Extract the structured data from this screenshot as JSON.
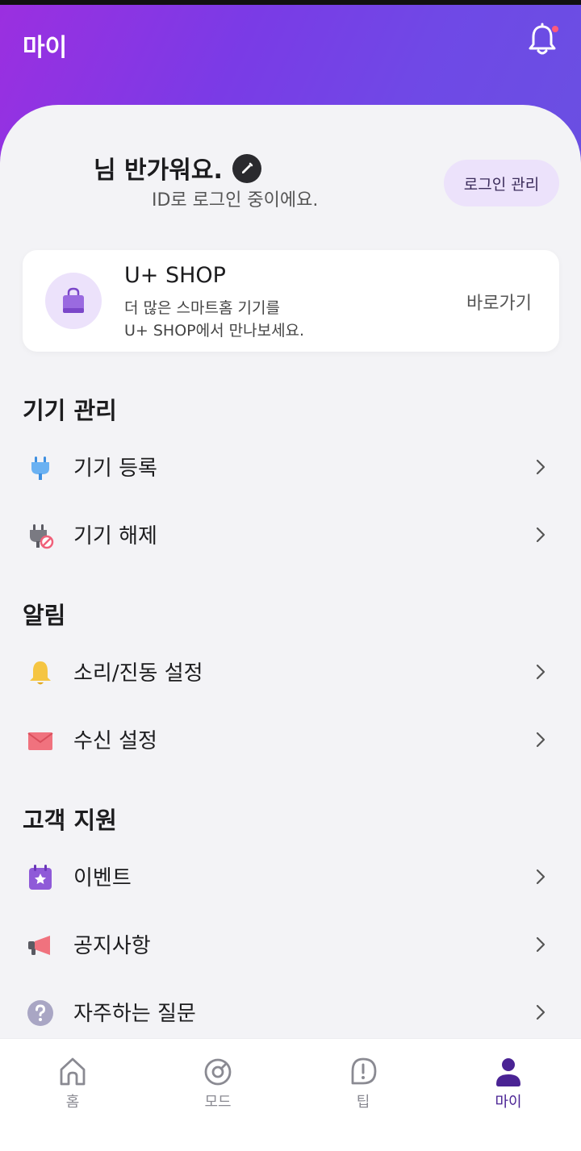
{
  "header": {
    "title": "마이",
    "notification_icon": "bell-icon",
    "has_unread": true
  },
  "profile": {
    "greeting": "님 반가워요.",
    "edit_icon": "pencil-icon",
    "login_status": "ID로 로그인 중이에요.",
    "login_manage_label": "로그인 관리"
  },
  "shop_banner": {
    "icon": "shopping-bag-icon",
    "title": "U+ SHOP",
    "desc_line1": "더 많은 스마트홈 기기를",
    "desc_line2": "U+ SHOP에서 만나보세요.",
    "link_label": "바로가기"
  },
  "sections": [
    {
      "title": "기기 관리",
      "items": [
        {
          "label": "기기 등록",
          "icon": "plug-icon"
        },
        {
          "label": "기기 해제",
          "icon": "plug-off-icon"
        }
      ]
    },
    {
      "title": "알림",
      "items": [
        {
          "label": "소리/진동 설정",
          "icon": "bell-icon"
        },
        {
          "label": "수신 설정",
          "icon": "envelope-icon"
        }
      ]
    },
    {
      "title": "고객 지원",
      "items": [
        {
          "label": "이벤트",
          "icon": "calendar-star-icon"
        },
        {
          "label": "공지사항",
          "icon": "megaphone-icon"
        },
        {
          "label": "자주하는 질문",
          "icon": "question-icon"
        }
      ]
    }
  ],
  "bottom_nav": [
    {
      "label": "홈",
      "icon": "home-icon",
      "active": false
    },
    {
      "label": "모드",
      "icon": "mode-icon",
      "active": false
    },
    {
      "label": "팁",
      "icon": "tip-icon",
      "active": false
    },
    {
      "label": "마이",
      "icon": "person-icon",
      "active": true
    }
  ],
  "colors": {
    "accent": "#4a2394",
    "header_start": "#9b2fe0",
    "header_end": "#6a4fe2",
    "chip_bg": "#ece2fb"
  }
}
